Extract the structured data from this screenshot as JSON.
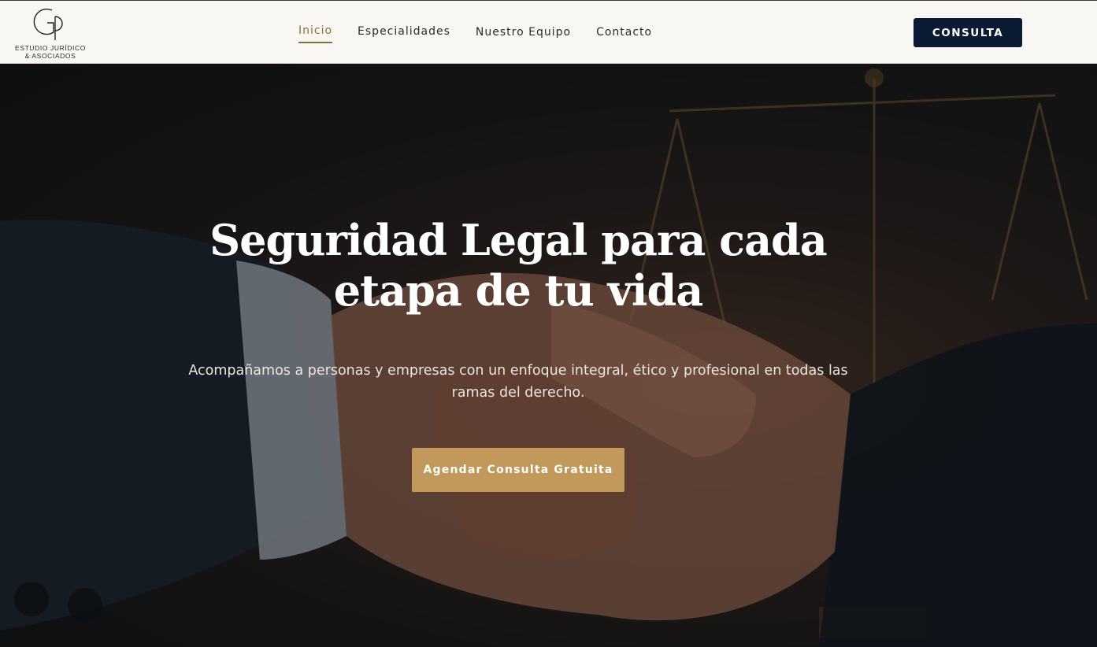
{
  "brand": {
    "logo_line1": "ESTUDIO JURÍDICO",
    "logo_line2": "& ASOCIADOS",
    "logo_icon": "gp-monogram-icon"
  },
  "nav": {
    "items": [
      {
        "label": "Inicio",
        "active": true
      },
      {
        "label": "Especialidades",
        "active": false
      },
      {
        "label": "Nuestro Equipo",
        "active": false
      },
      {
        "label": "Contacto",
        "active": false
      }
    ],
    "cta_label": "CONSULTA"
  },
  "hero": {
    "title": "Seguridad Legal para cada etapa de tu vida",
    "subtitle": "Acompañamos a personas y empresas con un enfoque integral, ético y profesional en todas las ramas del derecho.",
    "button_label": "Agendar Consulta Gratuita",
    "image": "handshake-scales-of-justice"
  },
  "colors": {
    "accent_gold": "#c19a5b",
    "nav_active": "#8b6d3a",
    "navy": "#0b1b33",
    "header_bg": "#f8f7f4"
  }
}
